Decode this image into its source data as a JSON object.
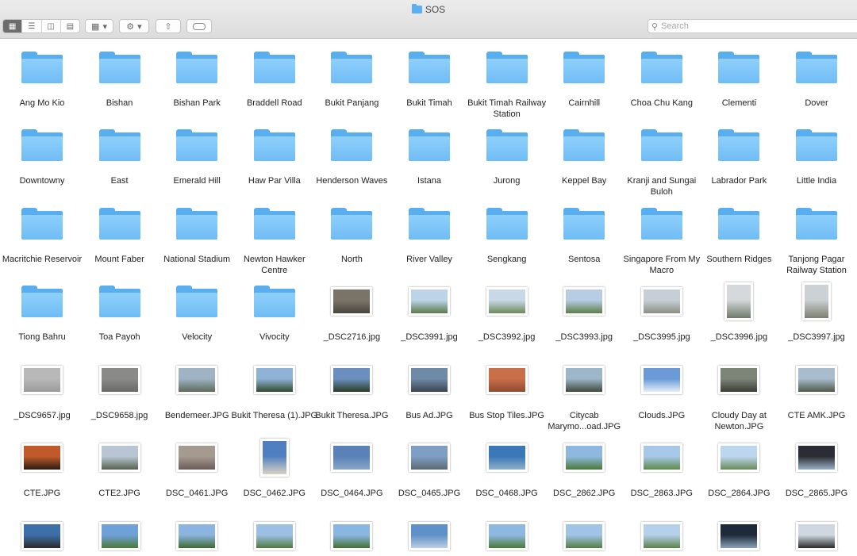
{
  "window": {
    "title": "SOS"
  },
  "toolbar": {
    "view_modes": [
      "icon-view-icon",
      "list-view-icon",
      "column-view-icon",
      "gallery-view-icon"
    ],
    "group_label": "▾",
    "action_label": "▾",
    "search_placeholder": "Search"
  },
  "rows": [
    [
      {
        "name": "Ang Mo Kio",
        "type": "folder"
      },
      {
        "name": "Bishan",
        "type": "folder"
      },
      {
        "name": "Bishan Park",
        "type": "folder"
      },
      {
        "name": "Braddell Road",
        "type": "folder"
      },
      {
        "name": "Bukit Panjang",
        "type": "folder"
      },
      {
        "name": "Bukit Timah",
        "type": "folder"
      },
      {
        "name": "Bukit Timah Railway Station",
        "type": "folder"
      },
      {
        "name": "Cairnhill",
        "type": "folder"
      },
      {
        "name": "Choa Chu Kang",
        "type": "folder"
      },
      {
        "name": "Clementi",
        "type": "folder"
      },
      {
        "name": "Dover",
        "type": "folder"
      }
    ],
    [
      {
        "name": "Downtowny",
        "type": "folder"
      },
      {
        "name": "East",
        "type": "folder"
      },
      {
        "name": "Emerald Hill",
        "type": "folder"
      },
      {
        "name": "Haw Par Villa",
        "type": "folder"
      },
      {
        "name": "Henderson Waves",
        "type": "folder"
      },
      {
        "name": "Istana",
        "type": "folder"
      },
      {
        "name": "Jurong",
        "type": "folder"
      },
      {
        "name": "Keppel Bay",
        "type": "folder"
      },
      {
        "name": "Kranji and Sungai Buloh",
        "type": "folder"
      },
      {
        "name": "Labrador Park",
        "type": "folder"
      },
      {
        "name": "Little India",
        "type": "folder"
      }
    ],
    [
      {
        "name": "Macritchie Reservoir",
        "type": "folder"
      },
      {
        "name": "Mount Faber",
        "type": "folder"
      },
      {
        "name": "National Stadium",
        "type": "folder"
      },
      {
        "name": "Newton Hawker Centre",
        "type": "folder"
      },
      {
        "name": "North",
        "type": "folder"
      },
      {
        "name": "River Valley",
        "type": "folder"
      },
      {
        "name": "Sengkang",
        "type": "folder"
      },
      {
        "name": "Sentosa",
        "type": "folder"
      },
      {
        "name": "Singapore From My Macro",
        "type": "folder"
      },
      {
        "name": "Southern Ridges",
        "type": "folder"
      },
      {
        "name": "Tanjong Pagar Railway Station",
        "type": "folder"
      }
    ],
    [
      {
        "name": "Tiong Bahru",
        "type": "folder"
      },
      {
        "name": "Toa Payoh",
        "type": "folder"
      },
      {
        "name": "Velocity",
        "type": "folder"
      },
      {
        "name": "Vivocity",
        "type": "folder"
      },
      {
        "name": "_DSC2716.jpg",
        "type": "image",
        "orient": "land",
        "colors": [
          "#7a7468",
          "#4a463e"
        ]
      },
      {
        "name": "_DSC3991.jpg",
        "type": "image",
        "orient": "land",
        "colors": [
          "#bcd3e8",
          "#5b7a4a"
        ]
      },
      {
        "name": "_DSC3992.jpg",
        "type": "image",
        "orient": "land",
        "colors": [
          "#c9d8e6",
          "#6d8a5a"
        ]
      },
      {
        "name": "_DSC3993.jpg",
        "type": "image",
        "orient": "land",
        "colors": [
          "#b7cde3",
          "#5d7f48"
        ]
      },
      {
        "name": "_DSC3995.jpg",
        "type": "image",
        "orient": "land",
        "colors": [
          "#c6cfd6",
          "#8a8f82"
        ]
      },
      {
        "name": "_DSC3996.jpg",
        "type": "image",
        "orient": "port",
        "colors": [
          "#d5d9dc",
          "#6f7a6a"
        ]
      },
      {
        "name": "_DSC3997.jpg",
        "type": "image",
        "orient": "port",
        "colors": [
          "#ccd1d5",
          "#7d7f72"
        ]
      }
    ],
    [
      {
        "name": "_DSC9657.jpg",
        "type": "image",
        "orient": "land",
        "colors": [
          "#b8b8b8",
          "#9a9a9a"
        ]
      },
      {
        "name": "_DSC9658.jpg",
        "type": "image",
        "orient": "land",
        "colors": [
          "#8a8a88",
          "#6a6a68"
        ]
      },
      {
        "name": "Bendemeer.JPG",
        "type": "image",
        "orient": "land",
        "colors": [
          "#9fb3c4",
          "#5d6a58"
        ]
      },
      {
        "name": "Bukit Theresa (1).JPG",
        "type": "image",
        "orient": "land",
        "colors": [
          "#8fb2d6",
          "#2f4a2a"
        ]
      },
      {
        "name": "Bukit Theresa.JPG",
        "type": "image",
        "orient": "land",
        "colors": [
          "#6a8fbf",
          "#2a3d24"
        ]
      },
      {
        "name": "Bus Ad.JPG",
        "type": "image",
        "orient": "land",
        "colors": [
          "#6f8aa6",
          "#3b4450"
        ]
      },
      {
        "name": "Bus Stop Tiles.JPG",
        "type": "image",
        "orient": "land",
        "colors": [
          "#c96f4a",
          "#8e4a30"
        ]
      },
      {
        "name": "Citycab Marymo...oad.JPG",
        "type": "image",
        "orient": "land",
        "colors": [
          "#9db6c9",
          "#3d4a3a"
        ]
      },
      {
        "name": "Clouds.JPG",
        "type": "image",
        "orient": "land",
        "colors": [
          "#6a9ad8",
          "#e4eef8"
        ]
      },
      {
        "name": "Cloudy Day at Newton.JPG",
        "type": "image",
        "orient": "land",
        "colors": [
          "#7d8478",
          "#3a3f36"
        ]
      },
      {
        "name": "CTE AMK.JPG",
        "type": "image",
        "orient": "land",
        "colors": [
          "#a8bccd",
          "#4f5a48"
        ]
      }
    ],
    [
      {
        "name": "CTE.JPG",
        "type": "image",
        "orient": "land",
        "colors": [
          "#c05a2a",
          "#2a1a14"
        ]
      },
      {
        "name": "CTE2.JPG",
        "type": "image",
        "orient": "land",
        "colors": [
          "#b7c6d2",
          "#57614f"
        ]
      },
      {
        "name": "DSC_0461.JPG",
        "type": "image",
        "orient": "land",
        "colors": [
          "#a59a90",
          "#6a5c58"
        ]
      },
      {
        "name": "DSC_0462.JPG",
        "type": "image",
        "orient": "port",
        "colors": [
          "#4f7fc0",
          "#d8d2c4"
        ]
      },
      {
        "name": "DSC_0464.JPG",
        "type": "image",
        "orient": "land",
        "colors": [
          "#5a82b6",
          "#8aa6c6"
        ]
      },
      {
        "name": "DSC_0465.JPG",
        "type": "image",
        "orient": "land",
        "colors": [
          "#7e9ec4",
          "#5d6b72"
        ]
      },
      {
        "name": "DSC_0468.JPG",
        "type": "image",
        "orient": "land",
        "colors": [
          "#3a78b8",
          "#8fb0c8"
        ]
      },
      {
        "name": "DSC_2862.JPG",
        "type": "image",
        "orient": "land",
        "colors": [
          "#8fb8e0",
          "#4a7a38"
        ]
      },
      {
        "name": "DSC_2863.JPG",
        "type": "image",
        "orient": "land",
        "colors": [
          "#a7c8e8",
          "#5f8a4a"
        ]
      },
      {
        "name": "DSC_2864.JPG",
        "type": "image",
        "orient": "land",
        "colors": [
          "#bcd6ee",
          "#6b8a58"
        ]
      },
      {
        "name": "DSC_2865.JPG",
        "type": "image",
        "orient": "land",
        "colors": [
          "#2a2e34",
          "#9ab0c4"
        ]
      }
    ],
    [
      {
        "name": "",
        "type": "image",
        "orient": "land",
        "colors": [
          "#3e6fa8",
          "#2a2a2a"
        ]
      },
      {
        "name": "",
        "type": "image",
        "orient": "land",
        "colors": [
          "#6fa0d8",
          "#4a7a38"
        ]
      },
      {
        "name": "",
        "type": "image",
        "orient": "land",
        "colors": [
          "#8cb4e0",
          "#3f6a30"
        ]
      },
      {
        "name": "",
        "type": "image",
        "orient": "land",
        "colors": [
          "#9cc0e4",
          "#4f7a3c"
        ]
      },
      {
        "name": "",
        "type": "image",
        "orient": "land",
        "colors": [
          "#8ab6e2",
          "#447030"
        ]
      },
      {
        "name": "",
        "type": "image",
        "orient": "land",
        "colors": [
          "#5f90c8",
          "#bcd0e0"
        ]
      },
      {
        "name": "",
        "type": "image",
        "orient": "land",
        "colors": [
          "#8fb8e0",
          "#4a7a38"
        ]
      },
      {
        "name": "",
        "type": "image",
        "orient": "land",
        "colors": [
          "#a0c4e6",
          "#557e42"
        ]
      },
      {
        "name": "",
        "type": "image",
        "orient": "land",
        "colors": [
          "#b4d0ea",
          "#5d8248"
        ]
      },
      {
        "name": "",
        "type": "image",
        "orient": "land",
        "colors": [
          "#1e2a3a",
          "#8aa2b8"
        ]
      },
      {
        "name": "",
        "type": "image",
        "orient": "land",
        "colors": [
          "#cfd8e0",
          "#2a2a2a"
        ]
      }
    ]
  ]
}
